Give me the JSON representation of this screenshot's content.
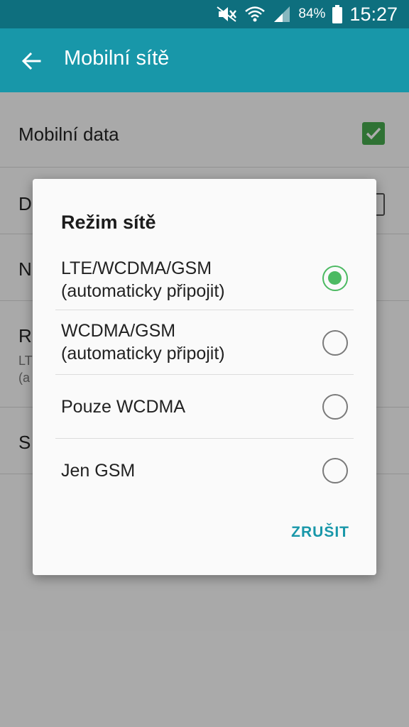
{
  "status_bar": {
    "battery_percent": "84%",
    "time": "15:27",
    "icons": [
      "mute-icon",
      "wifi-icon",
      "signal-icon",
      "battery-icon"
    ]
  },
  "app_bar": {
    "title": "Mobilní sítě",
    "back_icon": "arrow-back-icon"
  },
  "settings": {
    "rows": [
      {
        "label": "Mobilní data",
        "checkbox": true
      },
      {
        "label": "D",
        "checkbox": false
      },
      {
        "label": "N"
      },
      {
        "label": "R",
        "sub1": "LT",
        "sub2": "(a"
      },
      {
        "label": "S"
      }
    ]
  },
  "dialog": {
    "title": "Režim sítě",
    "options": [
      {
        "line1": "LTE/WCDMA/GSM",
        "line2": "(automaticky připojit)",
        "selected": true
      },
      {
        "line1": "WCDMA/GSM",
        "line2": "(automaticky připojit)",
        "selected": false
      },
      {
        "line1": "Pouze WCDMA",
        "selected": false
      },
      {
        "line1": "Jen GSM",
        "selected": false
      }
    ],
    "cancel_label": "ZRUŠIT"
  },
  "colors": {
    "status_bar": "#0e6f7e",
    "app_bar": "#1897a9",
    "accent_green": "#4cba62",
    "checkbox_green": "#46a84d"
  }
}
